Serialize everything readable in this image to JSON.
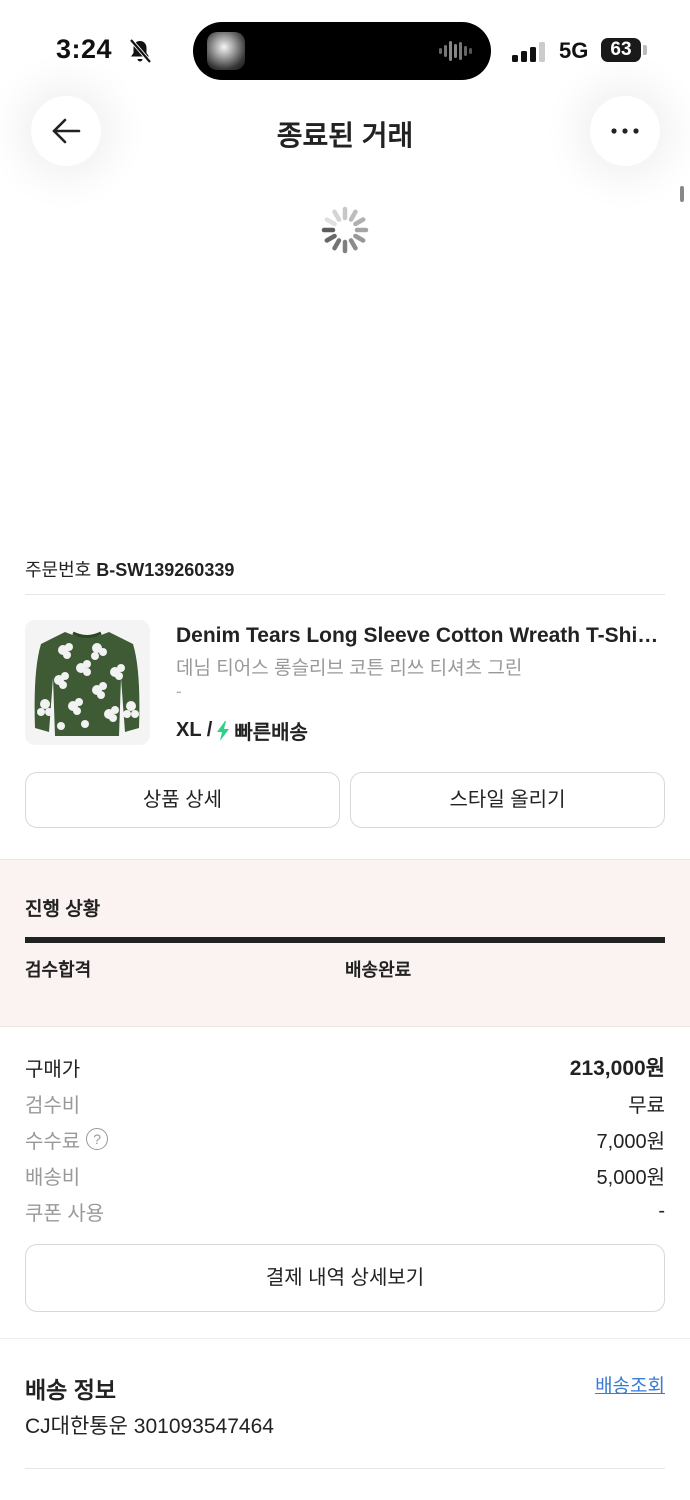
{
  "status_bar": {
    "time": "3:24",
    "network": "5G",
    "battery": "63"
  },
  "header": {
    "title": "종료된 거래",
    "back_icon": "arrow-left-icon",
    "more_icon": "more-horizontal-icon"
  },
  "order": {
    "label": "주문번호",
    "number": "B-SW139260339"
  },
  "product": {
    "name": "Denim Tears Long Sleeve Cotton Wreath T-Shirt Green",
    "subtitle": "데님 티어스 롱슬리브 코튼 리쓰 티셔츠 그린",
    "dash": "-",
    "size": "XL /",
    "delivery": "빠른배송",
    "delivery_color": "#2fd186"
  },
  "buttons": {
    "product_detail": "상품 상세",
    "upload_style": "스타일 올리기",
    "payment_detail": "결제 내역 상세보기"
  },
  "progress": {
    "title": "진행 상황",
    "steps": [
      "검수합격",
      "배송완료"
    ],
    "completion": 1.0
  },
  "prices": [
    {
      "label": "구매가",
      "value": "213,000원"
    },
    {
      "label": "검수비",
      "value": "무료"
    },
    {
      "label": "수수료",
      "value": "7,000원"
    },
    {
      "label": "배송비",
      "value": "5,000원"
    },
    {
      "label": "쿠폰 사용",
      "value": "-"
    }
  ],
  "shipping": {
    "title": "배송 정보",
    "track_link": "배송조회",
    "carrier_tracking": "CJ대한통운 301093547464",
    "link_color": "#3a7bd5"
  },
  "colors": {
    "progress_bg": "#fbf3f2",
    "text_primary": "#222222",
    "text_secondary": "#999999"
  }
}
